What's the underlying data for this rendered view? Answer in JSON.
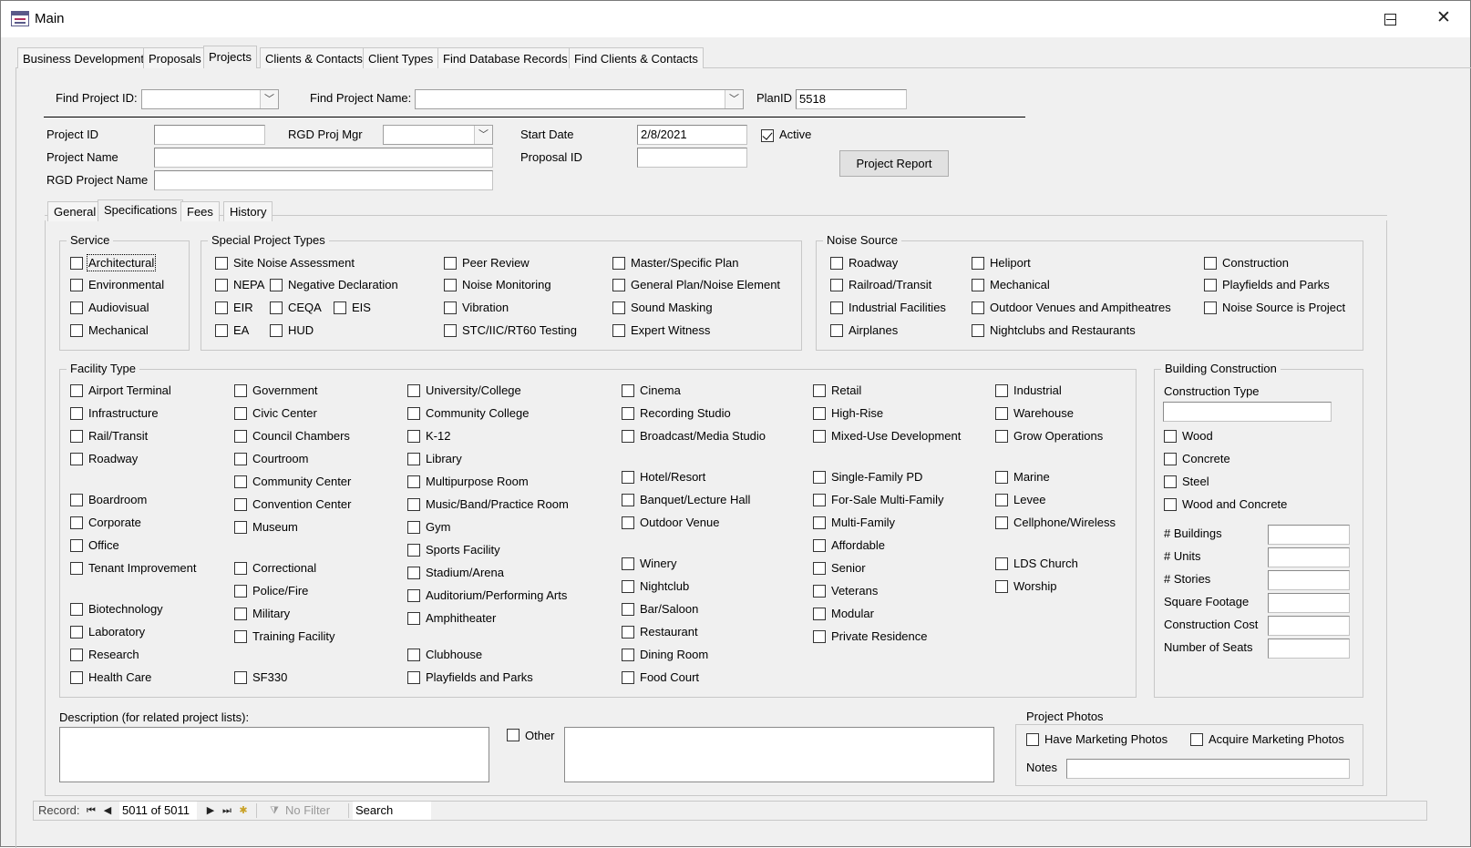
{
  "window": {
    "title": "Main",
    "minimize": "—",
    "maximize": "☐",
    "close": "✕"
  },
  "main_tabs": [
    "Business Development",
    "Proposals",
    "Projects",
    "Clients & Contacts",
    "Client Types",
    "Find Database Records",
    "Find Clients & Contacts"
  ],
  "find": {
    "project_id_label": "Find Project ID:",
    "project_id_value": "",
    "project_name_label": "Find Project Name:",
    "project_name_value": "",
    "planid_label": "PlanID",
    "planid_value": "5518"
  },
  "fields": {
    "project_id_label": "Project ID",
    "project_id_value": "",
    "rgd_proj_mgr_label": "RGD Proj Mgr",
    "rgd_proj_mgr_value": "",
    "start_date_label": "Start Date",
    "start_date_value": "2/8/2021",
    "active_label": "Active",
    "active_checked": true,
    "project_name_label": "Project Name",
    "project_name_value": "",
    "proposal_id_label": "Proposal ID",
    "proposal_id_value": "",
    "rgd_project_name_label": "RGD Project Name",
    "rgd_project_name_value": "",
    "project_report_button": "Project Report"
  },
  "sub_tabs": [
    "General",
    "Specifications",
    "Fees",
    "History"
  ],
  "service": {
    "title": "Service",
    "items": [
      "Architectural",
      "Environmental",
      "Audiovisual",
      "Mechanical"
    ]
  },
  "special": {
    "title": "Special Project Types",
    "items": [
      "Site Noise Assessment",
      "NEPA",
      "Negative Declaration",
      "EIR",
      "CEQA",
      "EIS",
      "EA",
      "HUD",
      "Peer Review",
      "Noise Monitoring",
      "Vibration",
      "STC/IIC/RT60 Testing",
      "Master/Specific Plan",
      "General Plan/Noise Element",
      "Sound Masking",
      "Expert Witness"
    ]
  },
  "noise": {
    "title": "Noise Source",
    "items": [
      "Roadway",
      "Railroad/Transit",
      "Industrial Facilities",
      "Airplanes",
      "Heliport",
      "Mechanical",
      "Outdoor Venues and Ampitheatres",
      "Nightclubs and Restaurants",
      "Construction",
      "Playfields and Parks",
      "Noise Source is Project"
    ]
  },
  "facility": {
    "title": "Facility Type",
    "col1": [
      "Airport Terminal",
      "Infrastructure",
      "Rail/Transit",
      "Roadway",
      "Boardroom",
      "Corporate",
      "Office",
      "Tenant Improvement",
      "Biotechnology",
      "Laboratory",
      "Research",
      "Health Care"
    ],
    "col2": [
      "Government",
      "Civic Center",
      "Council Chambers",
      "Courtroom",
      "Community Center",
      "Convention Center",
      "Museum",
      "Correctional",
      "Police/Fire",
      "Military",
      "Training Facility",
      "SF330"
    ],
    "col3": [
      "University/College",
      "Community College",
      "K-12",
      "Library",
      "Multipurpose Room",
      "Music/Band/Practice Room",
      "Gym",
      "Sports Facility",
      "Stadium/Arena",
      "Auditorium/Performing Arts",
      "Amphitheater",
      "Clubhouse",
      "Playfields and Parks"
    ],
    "col4": [
      "Cinema",
      "Recording Studio",
      "Broadcast/Media Studio",
      "Hotel/Resort",
      "Banquet/Lecture Hall",
      "Outdoor Venue",
      "Winery",
      "Nightclub",
      "Bar/Saloon",
      "Restaurant",
      "Dining Room",
      "Food Court"
    ],
    "col5": [
      "Retail",
      "High-Rise",
      "Mixed-Use Development",
      "Single-Family PD",
      "For-Sale Multi-Family",
      "Multi-Family",
      "Affordable",
      "Senior",
      "Veterans",
      "Modular",
      "Private Residence"
    ],
    "col6": [
      "Industrial",
      "Warehouse",
      "Grow Operations",
      "Marine",
      "Levee",
      "Cellphone/Wireless",
      "LDS Church",
      "Worship"
    ]
  },
  "building": {
    "title": "Building Construction",
    "type_label": "Construction Type",
    "type_value": "",
    "materials": [
      "Wood",
      "Concrete",
      "Steel",
      "Wood and Concrete"
    ],
    "metrics": [
      "# Buildings",
      "# Units",
      "# Stories",
      "Square Footage",
      "Construction Cost",
      "Number of Seats"
    ]
  },
  "description": {
    "label": "Description (for related project lists):",
    "value": "",
    "other_label": "Other",
    "other_value": ""
  },
  "photos": {
    "title": "Project Photos",
    "have": "Have Marketing Photos",
    "acquire": "Acquire Marketing Photos",
    "notes_label": "Notes",
    "notes_value": ""
  },
  "record_nav": {
    "label": "Record:",
    "position": "5011 of 5011",
    "filter": "No Filter",
    "search": "Search"
  }
}
